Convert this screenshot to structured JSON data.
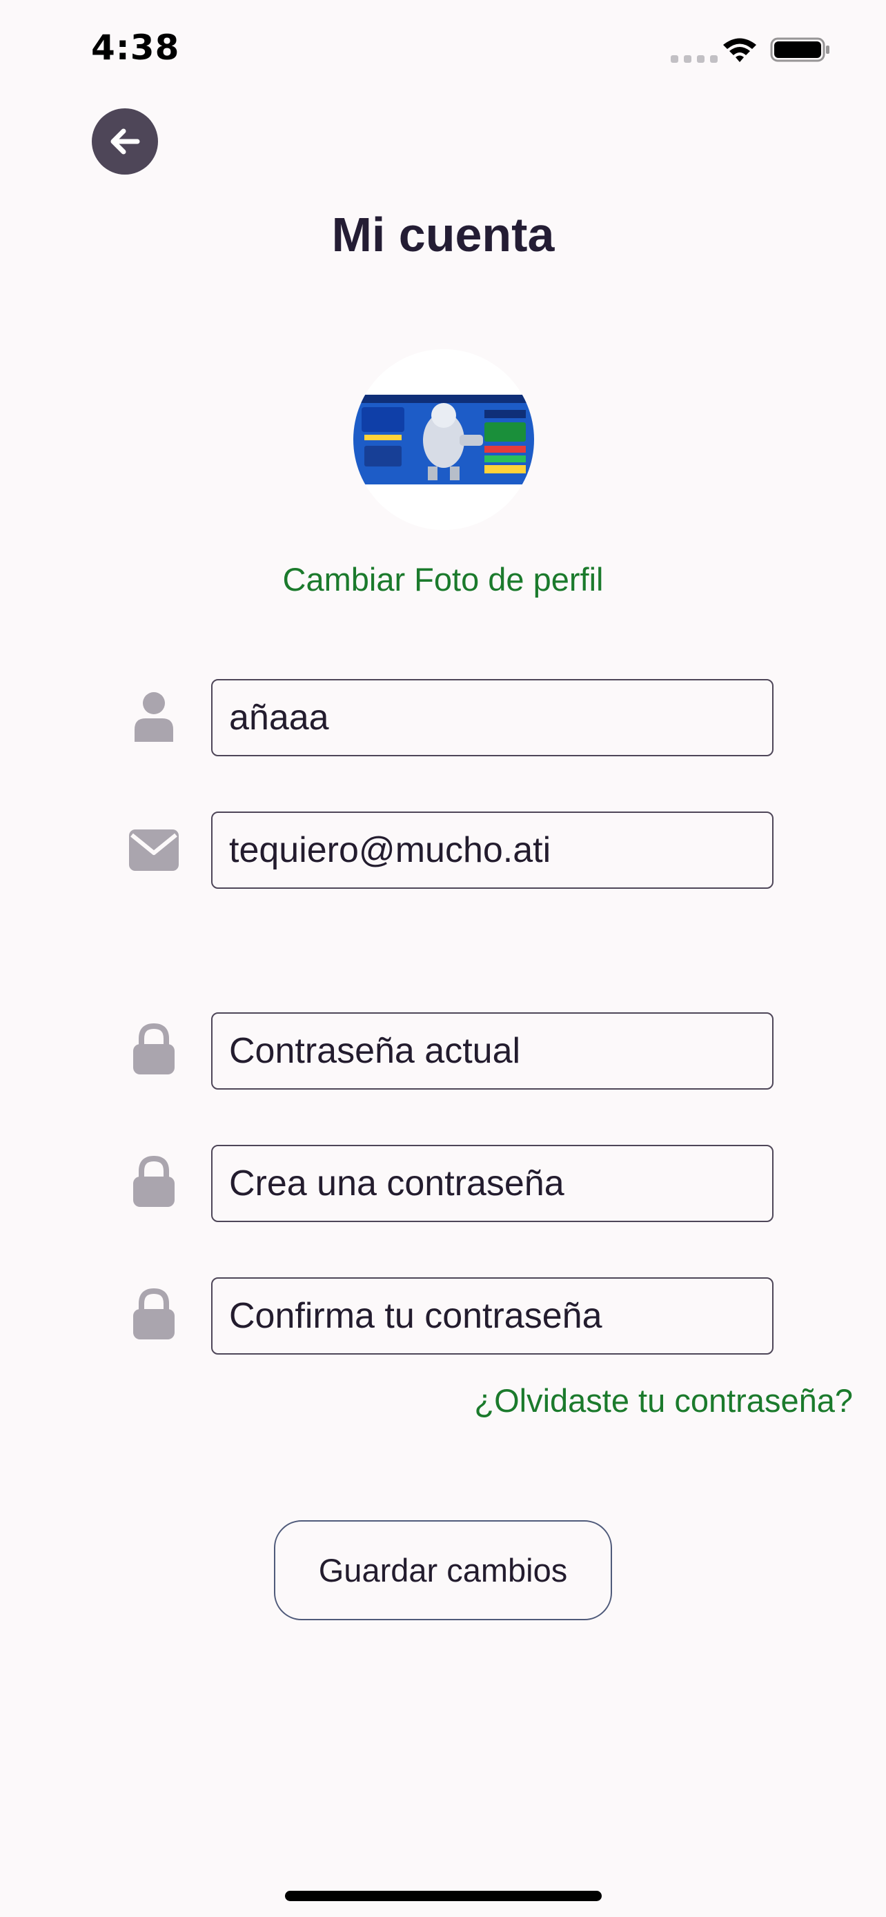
{
  "status_bar": {
    "time": "4:38"
  },
  "header": {
    "title": "Mi cuenta",
    "back_icon": "arrow-left-icon"
  },
  "profile": {
    "change_photo_label": "Cambiar Foto de perfil"
  },
  "form": {
    "username": {
      "value": "añaaa",
      "icon": "user-icon"
    },
    "email": {
      "value": "tequiero@mucho.ati",
      "icon": "mail-icon"
    },
    "current_password": {
      "placeholder": "Contraseña actual",
      "icon": "lock-icon"
    },
    "new_password": {
      "placeholder": "Crea una contraseña",
      "icon": "lock-icon"
    },
    "confirm_password": {
      "placeholder": "Confirma tu contraseña",
      "icon": "lock-icon"
    },
    "forgot_password_label": "¿Olvidaste tu contraseña?",
    "save_label": "Guardar cambios"
  },
  "colors": {
    "background": "#fcf9fa",
    "accent_green": "#1b7a2c",
    "back_button": "#4e4658",
    "icon_gray": "#aaa5ae",
    "text_dark": "#231c2e"
  }
}
